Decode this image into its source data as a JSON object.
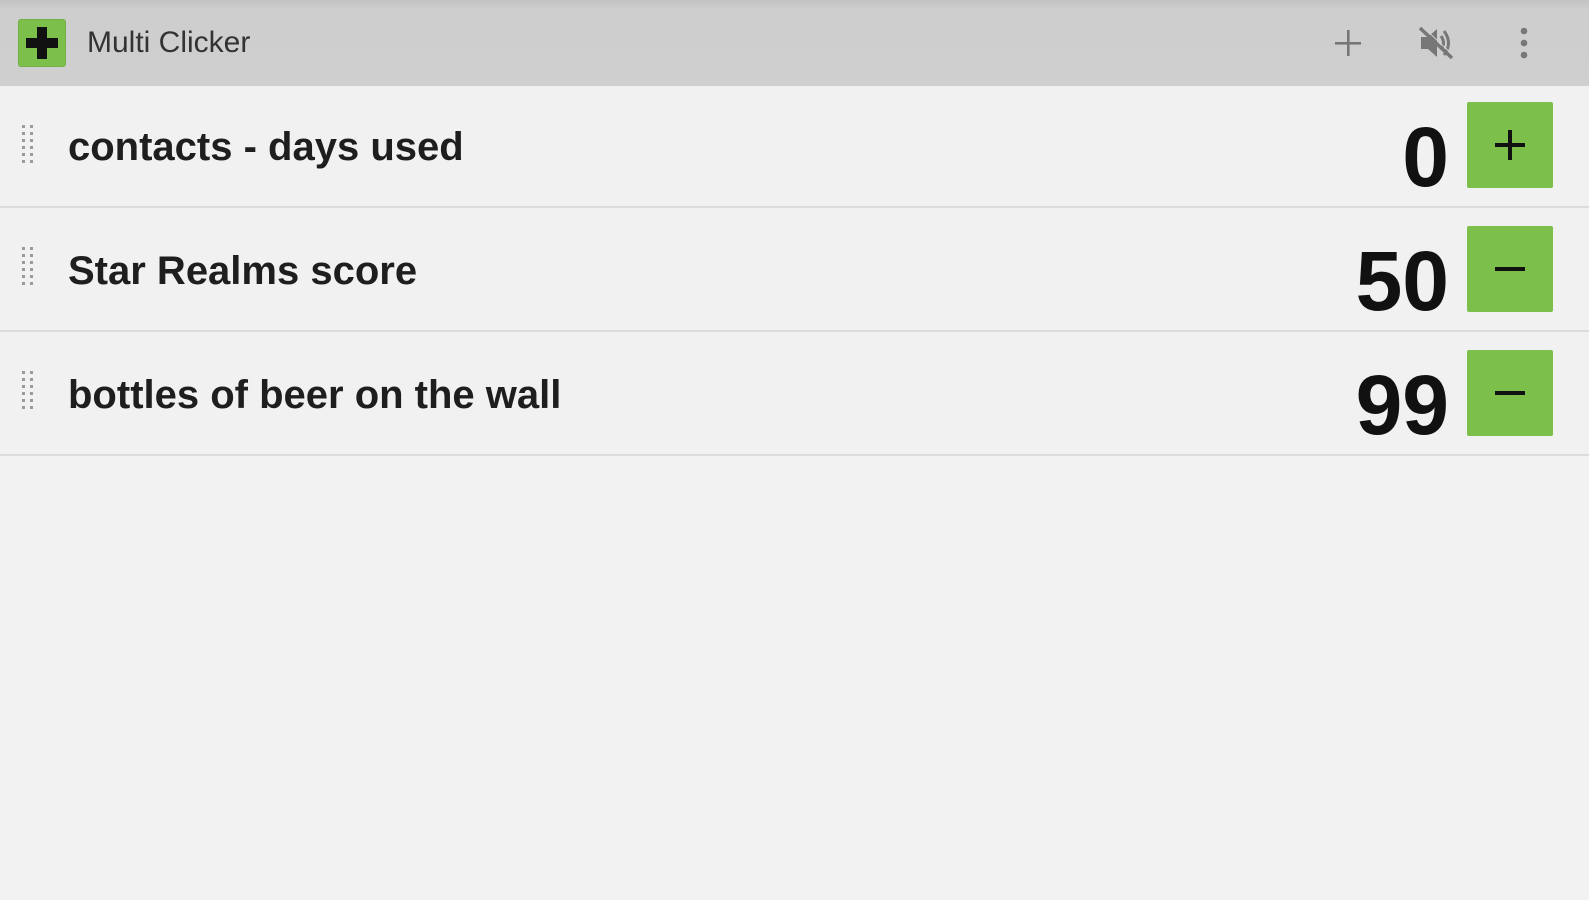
{
  "app": {
    "title": "Multi Clicker",
    "icon": "app-plus-icon",
    "accent_color": "#7cc04b"
  },
  "actions": [
    {
      "icon": "add-icon",
      "label": "Add counter"
    },
    {
      "icon": "volume-off-icon",
      "label": "Mute"
    },
    {
      "icon": "overflow-menu-icon",
      "label": "More options"
    }
  ],
  "counters": [
    {
      "name": "contacts - days used",
      "value": "0",
      "button": "plus"
    },
    {
      "name": "Star Realms score",
      "value": "50",
      "button": "minus"
    },
    {
      "name": "bottles of beer on the wall",
      "value": "99",
      "button": "minus"
    }
  ]
}
